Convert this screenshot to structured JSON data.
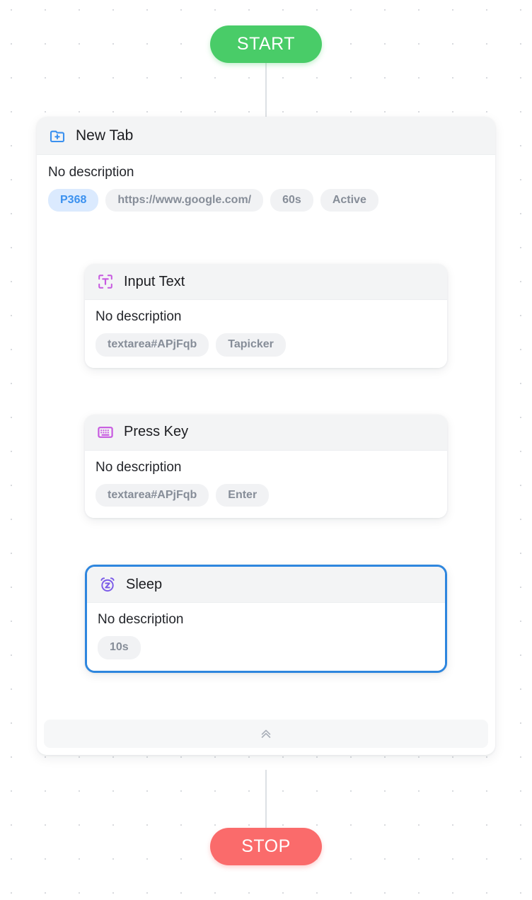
{
  "terminals": {
    "start": {
      "label": "START",
      "color": "#49cc68"
    },
    "stop": {
      "label": "STOP",
      "color": "#fa6b6b"
    }
  },
  "group_node": {
    "icon": "new-tab-icon",
    "icon_color": "#3b91ef",
    "title": "New Tab",
    "description": "No description",
    "badges": [
      {
        "label": "P368",
        "accent": true
      },
      {
        "label": "https://www.google.com/",
        "accent": false
      },
      {
        "label": "60s",
        "accent": false
      },
      {
        "label": "Active",
        "accent": false
      }
    ]
  },
  "children": [
    {
      "icon": "input-text-icon",
      "icon_color": "#c759e0",
      "title": "Input Text",
      "description": "No description",
      "selected": false,
      "badges": [
        {
          "label": "textarea#APjFqb"
        },
        {
          "label": "Tapicker"
        }
      ]
    },
    {
      "icon": "keyboard-icon",
      "icon_color": "#c759e0",
      "title": "Press Key",
      "description": "No description",
      "selected": false,
      "badges": [
        {
          "label": "textarea#APjFqb"
        },
        {
          "label": "Enter"
        }
      ]
    },
    {
      "icon": "alarm-sleep-icon",
      "icon_color": "#7c5ce8",
      "title": "Sleep",
      "description": "No description",
      "selected": true,
      "badges": [
        {
          "label": "10s"
        }
      ]
    }
  ],
  "collapse_bar": {
    "icon": "chevrons-up-icon",
    "icon_color": "#a8aeb8"
  }
}
